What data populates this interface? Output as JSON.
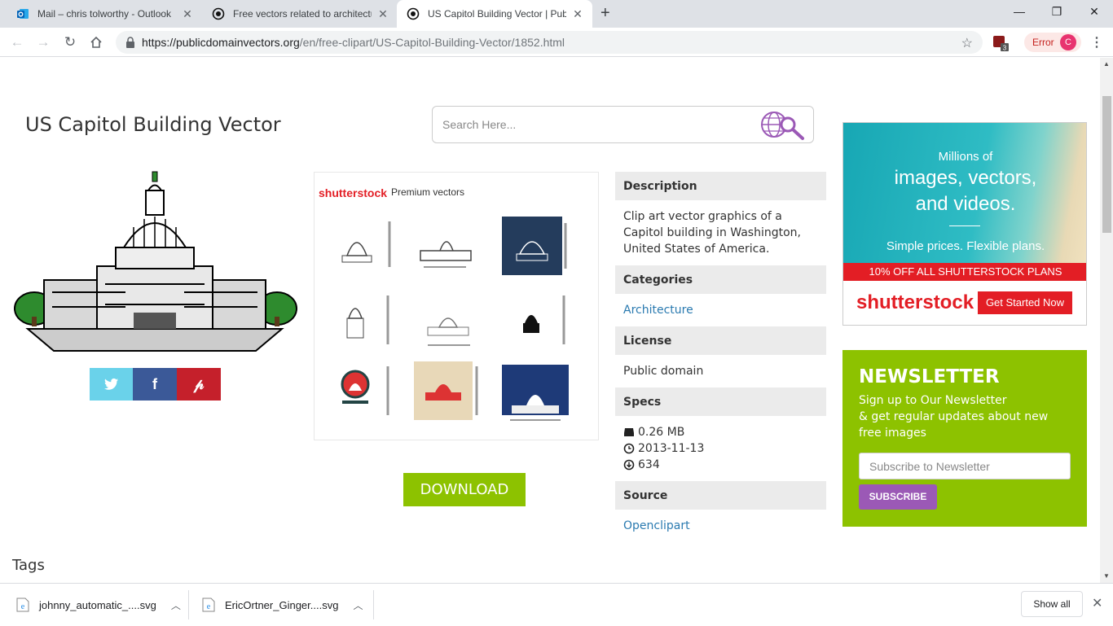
{
  "browser": {
    "tabs": [
      {
        "title": "Mail – chris tolworthy - Outlook",
        "active": false
      },
      {
        "title": "Free vectors related to architectu",
        "active": false
      },
      {
        "title": "US Capitol Building Vector | Publ",
        "active": true
      }
    ],
    "url_host": "https://publicdomainvectors.org",
    "url_path": "/en/free-clipart/US-Capitol-Building-Vector/1852.html",
    "error_label": "Error",
    "profile_initial": "C",
    "extension_badge": "3"
  },
  "page": {
    "title": "US Capitol Building Vector",
    "search_placeholder": "Search Here...",
    "shutterstock_brand": "shutterstock",
    "premium_label": "Premium vectors",
    "download_label": "DOWNLOAD",
    "tags_label": "Tags"
  },
  "details": {
    "description_heading": "Description",
    "description_text": "Clip art vector graphics of a Capitol building in Washington, United States of America.",
    "categories_heading": "Categories",
    "category": "Architecture",
    "license_heading": "License",
    "license": "Public domain",
    "specs_heading": "Specs",
    "size": "0.26 MB",
    "date": "2013-11-13",
    "downloads": "634",
    "source_heading": "Source",
    "source": "Openclipart"
  },
  "ad": {
    "line1": "Millions of",
    "line2": "images, vectors,",
    "line3": "and videos.",
    "line4": "Simple prices. Flexible plans.",
    "band": "10% OFF ALL SHUTTERSTOCK PLANS",
    "logo": "shutterstock",
    "cta": "Get Started Now"
  },
  "newsletter": {
    "heading": "NEWSLETTER",
    "line1": "Sign up to Our Newsletter",
    "line2": "& get regular updates about new free images",
    "placeholder": "Subscribe to Newsletter",
    "button": "SUBSCRIBE"
  },
  "downloads_bar": {
    "items": [
      {
        "name": "johnny_automatic_....svg"
      },
      {
        "name": "EricOrtner_Ginger....svg"
      }
    ],
    "show_all": "Show all"
  },
  "colors": {
    "accent_green": "#8dc200",
    "shutterstock_red": "#e31e25",
    "link_blue": "#2a7ab0",
    "subscribe_purple": "#9b59b6"
  }
}
